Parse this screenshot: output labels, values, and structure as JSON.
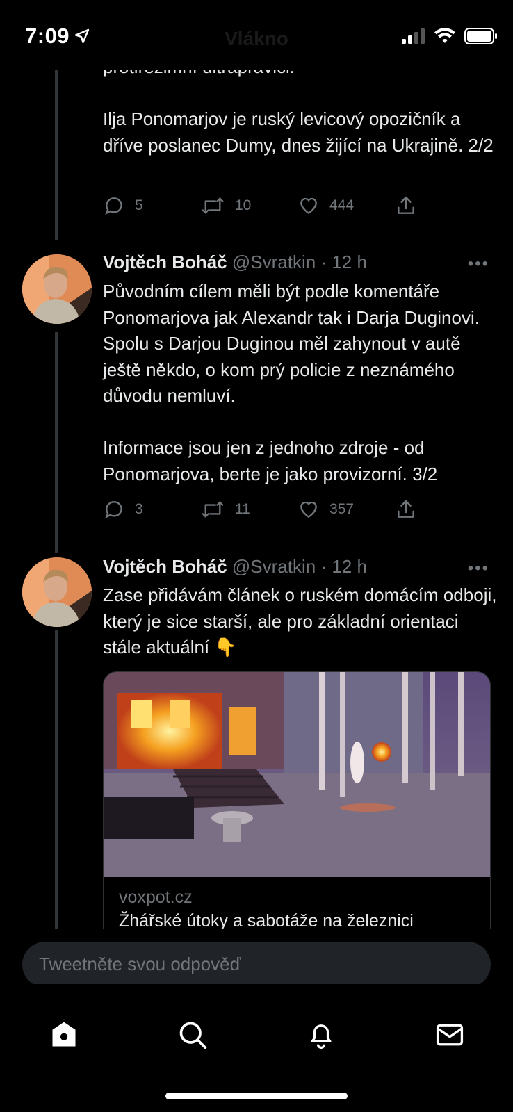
{
  "status_bar": {
    "time": "7:09",
    "header_ghost": "Vlákno"
  },
  "tweets": [
    {
      "partial_top": "protirežimní ultrapravici.",
      "text": "Ilja Ponomarjov je ruský levicový opozičník a dříve poslanec Dumy, dnes žijící na Ukrajině. 2/2",
      "replies": "5",
      "retweets": "10",
      "likes": "444"
    },
    {
      "name": "Vojtěch Boháč",
      "meta": "@Svratkin · 12 h",
      "text": "Původním cílem měli být podle komentáře Ponomarjova jak Alexandr tak i Darja Duginovi. Spolu s Darjou Duginou měl zahynout v autě ještě někdo, o kom prý policie z neznámého důvodu nemluví.\n\nInformace jsou jen z jednoho zdroje - od Ponomarjova, berte je jako provizorní. 3/2",
      "replies": "3",
      "retweets": "11",
      "likes": "357"
    },
    {
      "name": "Vojtěch Boháč",
      "meta": "@Svratkin · 12 h",
      "text": "Zase přidávám článek o ruském domácím odboji, který je sice starší, ale pro základní orientaci stále aktuální 👇",
      "card": {
        "domain": "voxpot.cz",
        "title": "Žhářské útoky a sabotáže na železnici"
      }
    }
  ],
  "more_label": "•••",
  "reply": {
    "placeholder": "Tweetněte svou odpověď"
  },
  "tabs": [
    "home-icon",
    "search-icon",
    "bell-icon",
    "mail-icon"
  ]
}
